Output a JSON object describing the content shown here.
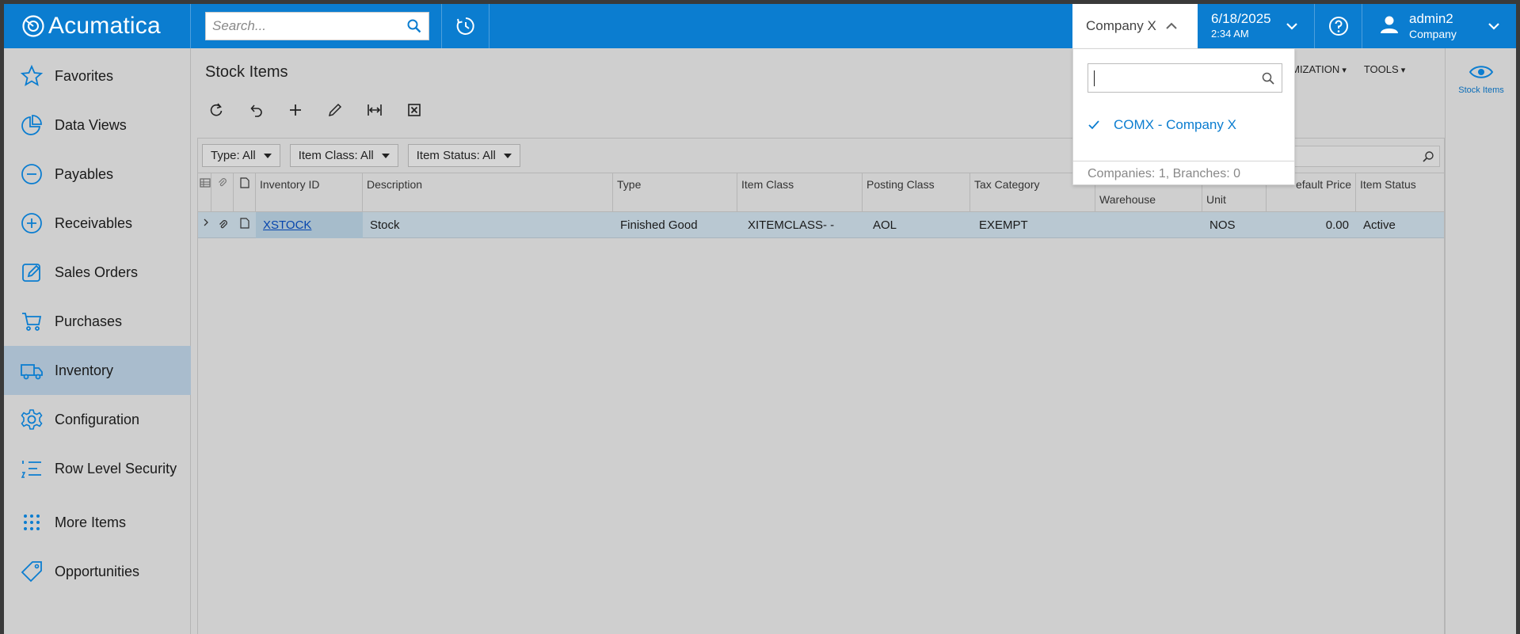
{
  "app": {
    "logo_text": "Acumatica"
  },
  "topbar": {
    "search_placeholder": "Search...",
    "company_label": "Company X",
    "date": "6/18/2025",
    "time": "2:34 AM",
    "user_name": "admin2",
    "user_company": "Company"
  },
  "sidebar": {
    "items": [
      {
        "label": "Favorites",
        "icon": "star-icon"
      },
      {
        "label": "Data Views",
        "icon": "pie-chart-icon"
      },
      {
        "label": "Payables",
        "icon": "minus-circle-icon"
      },
      {
        "label": "Receivables",
        "icon": "plus-circle-icon"
      },
      {
        "label": "Sales Orders",
        "icon": "edit-icon"
      },
      {
        "label": "Purchases",
        "icon": "cart-icon"
      },
      {
        "label": "Inventory",
        "icon": "truck-icon"
      },
      {
        "label": "Configuration",
        "icon": "gear-icon"
      },
      {
        "label": "Row Level Security",
        "icon": "list-icon"
      },
      {
        "label": "More Items",
        "icon": "grid-dots-icon"
      },
      {
        "label": "Opportunities",
        "icon": "tag-icon"
      }
    ],
    "active": "Inventory"
  },
  "main": {
    "title": "Stock Items",
    "menus": [
      "OMIZATION",
      "TOOLS"
    ],
    "filters": [
      "Type: All",
      "Item Class: All",
      "Item Status: All"
    ],
    "columns": {
      "inventory_id": "Inventory ID",
      "description": "Description",
      "type": "Type",
      "item_class": "Item Class",
      "posting_class": "Posting Class",
      "tax_category": "Tax Category",
      "warehouse": "Warehouse",
      "unit": "Unit",
      "default_price": "efault Price",
      "item_status": "Item Status"
    },
    "rows": [
      {
        "inventory_id": "XSTOCK",
        "description": "Stock",
        "type": "Finished Good",
        "item_class": "XITEMCLASS- -",
        "posting_class": "AOL",
        "tax_category": "EXEMPT",
        "warehouse": "",
        "unit": "NOS",
        "default_price": "0.00",
        "item_status": "Active"
      }
    ]
  },
  "rail": {
    "label": "Stock Items"
  },
  "company_dropdown": {
    "search_value": "",
    "item": "COMX - Company X",
    "footer": "Companies: 1, Branches: 0"
  },
  "colors": {
    "brand": "#0b7dd0",
    "active_nav": "#a9bccd",
    "selected_row": "#b9c8d2"
  }
}
